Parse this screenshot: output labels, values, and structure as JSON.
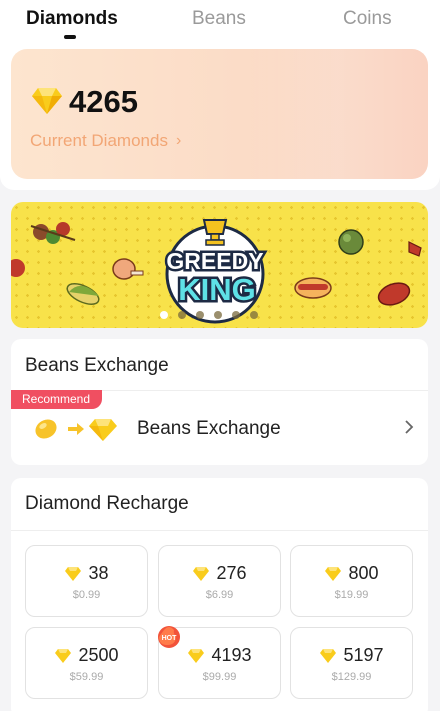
{
  "tabs": [
    {
      "label": "Diamonds",
      "active": true
    },
    {
      "label": "Beans",
      "active": false
    },
    {
      "label": "Coins",
      "active": false
    }
  ],
  "balance": {
    "value": "4265",
    "label": "Current Diamonds",
    "icon": "diamond-icon"
  },
  "banner": {
    "title_line1": "GREEDY",
    "title_line2": "KING",
    "slide_count": 6,
    "active_slide": 0
  },
  "beans_exchange": {
    "title": "Beans Exchange",
    "badge": "Recommend",
    "row_label": "Beans Exchange"
  },
  "recharge": {
    "title": "Diamond Recharge",
    "hot_badge": "HOT",
    "packages": [
      {
        "amount": "38",
        "price": "$0.99",
        "hot": false
      },
      {
        "amount": "276",
        "price": "$6.99",
        "hot": false
      },
      {
        "amount": "800",
        "price": "$19.99",
        "hot": false
      },
      {
        "amount": "2500",
        "price": "$59.99",
        "hot": false
      },
      {
        "amount": "4193",
        "price": "$99.99",
        "hot": true
      },
      {
        "amount": "5197",
        "price": "$129.99",
        "hot": false
      }
    ]
  },
  "colors": {
    "diamond": "#f9cc1c",
    "accent_orange": "#f2a675",
    "recommend_red": "#f04f61",
    "banner_yellow": "#f8e24a"
  }
}
